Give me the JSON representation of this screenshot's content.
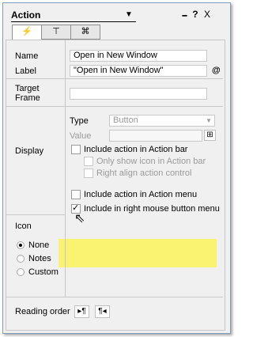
{
  "title": "Action",
  "titlebar_icons": {
    "drag": "▪▪▪▪",
    "help": "?",
    "close": "X"
  },
  "tabs": [
    {
      "icon": "lightning-icon",
      "glyph": "⚡"
    },
    {
      "icon": "underline-icon",
      "glyph": "⊤"
    },
    {
      "icon": "magic-icon",
      "glyph": "⌘"
    }
  ],
  "fields": {
    "name_label": "Name",
    "name_value": "Open in New Window",
    "label_label": "Label",
    "label_value": "\"Open in New Window\"",
    "at_symbol": "@",
    "target_label_1": "Target",
    "target_label_2": "Frame"
  },
  "display": {
    "section_label": "Display",
    "type_label": "Type",
    "type_value": "Button",
    "value_label": "Value",
    "include_action_bar": "Include action in Action bar",
    "only_icon": "Only show icon in Action bar",
    "right_align": "Right align action control",
    "include_menu": "Include action in Action menu",
    "include_right_mouse": "Include in right mouse button menu"
  },
  "icon_section": {
    "label": "Icon",
    "options": [
      "None",
      "Notes",
      "Custom"
    ],
    "selected": "None"
  },
  "reading_order": {
    "label": "Reading order",
    "ltr_glyph": "▸¶",
    "rtl_glyph": "¶◂"
  },
  "colors": {
    "highlight": "#fbf25a",
    "border": "#7f9db9"
  }
}
